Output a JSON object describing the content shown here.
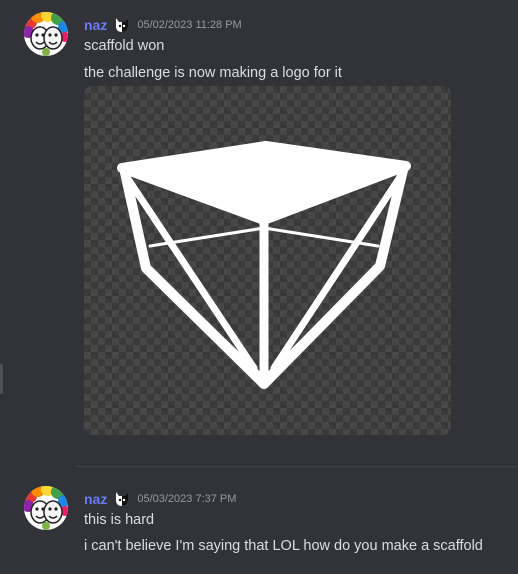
{
  "messages": [
    {
      "username": "naz",
      "timestamp": "05/02/2023 11:28 PM",
      "lines": [
        "scaffold won",
        "the challenge is now making a logo for it"
      ],
      "attachment": {
        "type": "image",
        "icon": "scaffold-logo"
      }
    },
    {
      "username": "naz",
      "timestamp": "05/03/2023 7:37 PM",
      "lines": [
        "this is hard",
        "i can't believe I'm saying that LOL how do you make a scaffold"
      ]
    }
  ],
  "colors": {
    "background": "#313338",
    "username": "#6a7bf6",
    "text": "#dbdee1",
    "timestamp": "#949ba4"
  }
}
